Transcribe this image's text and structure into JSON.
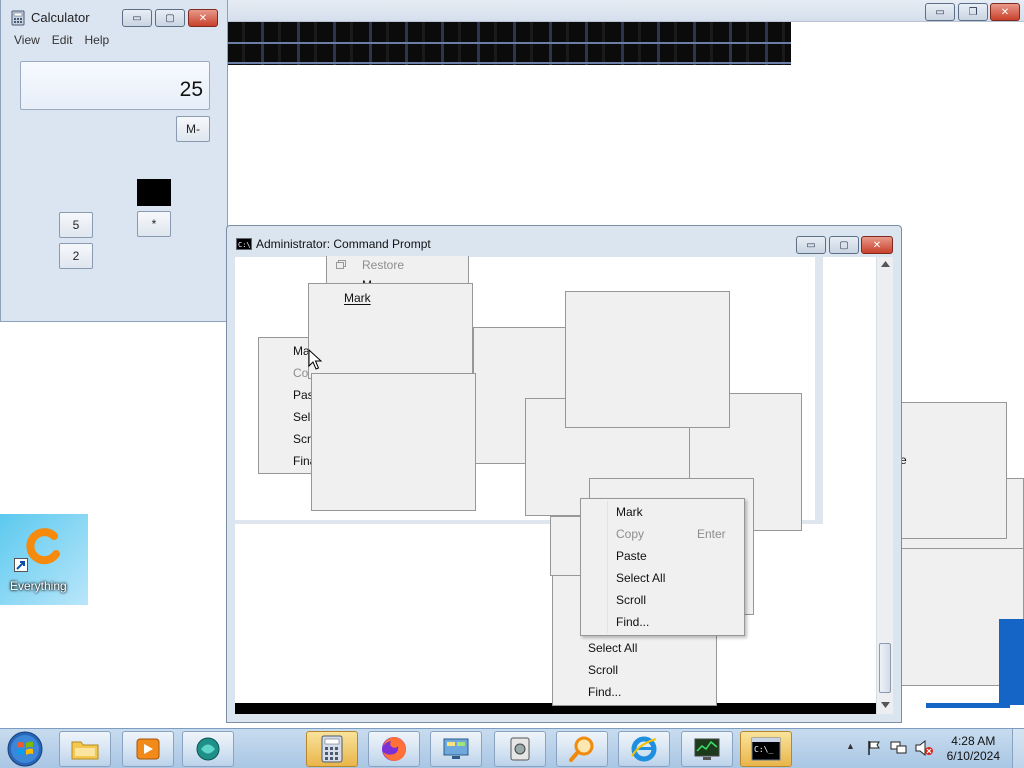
{
  "background_window": {
    "controls": {
      "minimize": "▭",
      "restore": "❐",
      "close": "✕"
    }
  },
  "calculator": {
    "title": "Calculator",
    "menu": [
      "View",
      "Edit",
      "Help"
    ],
    "display_value": "25",
    "buttons": {
      "m_minus": "M-",
      "five": "5",
      "two": "2",
      "multiply": "*"
    },
    "controls": {
      "minimize": "▭",
      "restore": "▢",
      "close": "✕"
    }
  },
  "cmd_window": {
    "title": "Administrator:  Command Prompt",
    "controls": {
      "minimize": "▭",
      "restore": "▢",
      "close": "✕"
    }
  },
  "system_menu": {
    "restore": "Restore",
    "partial": "M"
  },
  "mark_popup": {
    "label": "Mark"
  },
  "left_menu_partial": [
    "Ma",
    "Co",
    "Pas",
    "Sel",
    "Scro",
    "Fina"
  ],
  "context_menu": {
    "items": [
      {
        "label": "Mark",
        "disabled": false
      },
      {
        "label": "Copy",
        "shortcut": "Enter",
        "disabled": true
      },
      {
        "label": "Paste",
        "disabled": false
      },
      {
        "label": "Select All",
        "disabled": false
      },
      {
        "label": "Scroll",
        "disabled": false
      },
      {
        "label": "Find...",
        "disabled": false
      }
    ]
  },
  "lower_menu": {
    "items": [
      "Select All",
      "Scroll",
      "Find..."
    ]
  },
  "right_fragment": {
    "text": "e"
  },
  "desktop_icon": {
    "label": "Everything"
  },
  "taskbar": {
    "apps": [
      "start-orb",
      "file-explorer",
      "media-player",
      "app-teal",
      "calculator",
      "firefox",
      "control-panel",
      "app-disk",
      "search-everything",
      "internet-explorer",
      "task-monitor",
      "command-prompt"
    ],
    "clock_time": "4:28 AM",
    "clock_date": "6/10/2024",
    "tray_up": "▲"
  }
}
